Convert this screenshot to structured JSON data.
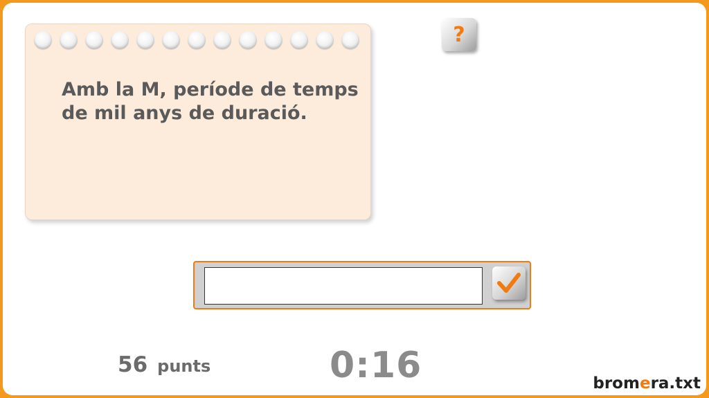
{
  "clue": {
    "line1": "Amb la M, període de temps",
    "line2": "de mil anys de duració."
  },
  "help_button": {
    "label": "?",
    "icon": "question-mark-icon"
  },
  "answer": {
    "value": "",
    "placeholder": ""
  },
  "submit_button": {
    "icon": "checkmark-icon"
  },
  "score": {
    "value": "56",
    "label": "punts"
  },
  "timer": {
    "value": "0:16"
  },
  "brand": {
    "part1": "brom",
    "accent": "e",
    "part2": "ra.txt"
  },
  "colors": {
    "frame": "#f39a1e",
    "accent": "#f07b12",
    "card_background": "#fdebdc",
    "text": "#5a5a5a"
  }
}
